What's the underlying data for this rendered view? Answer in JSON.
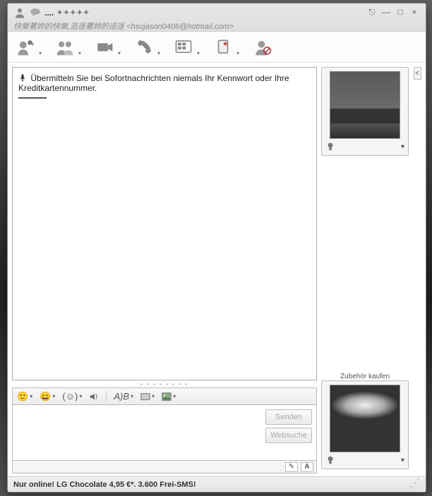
{
  "title": {
    "contact_name": ".... ",
    "status_line": "快樂著妳的快樂,追逐著妳的追逐 <hsujason0406@hotmail.com>"
  },
  "window_controls": {
    "pin": "⎋",
    "minimize": "—",
    "maximize": "□",
    "close": "×"
  },
  "toolbar": {
    "invite": "Invite",
    "send_file": "Send File",
    "video": "Video",
    "call": "Call",
    "activities": "Activities",
    "games": "Games",
    "block": "Block"
  },
  "history": {
    "security_msg": "Übermitteln Sie bei Sofortnachrichten niemals Ihr Kennwort oder Ihre Kreditkartennummer."
  },
  "side": {
    "accessories_label": "Zubehör kaufen"
  },
  "format": {
    "smiley": "😊",
    "wink": "😉",
    "voice": "🔊",
    "font": "A)B",
    "bg": "▭",
    "img": "▧"
  },
  "compose": {
    "send": "Senden",
    "websearch": "Websuche",
    "handwrite": "✎",
    "font_toggle": "A"
  },
  "statusbar": {
    "ad": "Nur online! LG Chocolate 4,95 €*. 3.600 Frei-SMS!"
  }
}
